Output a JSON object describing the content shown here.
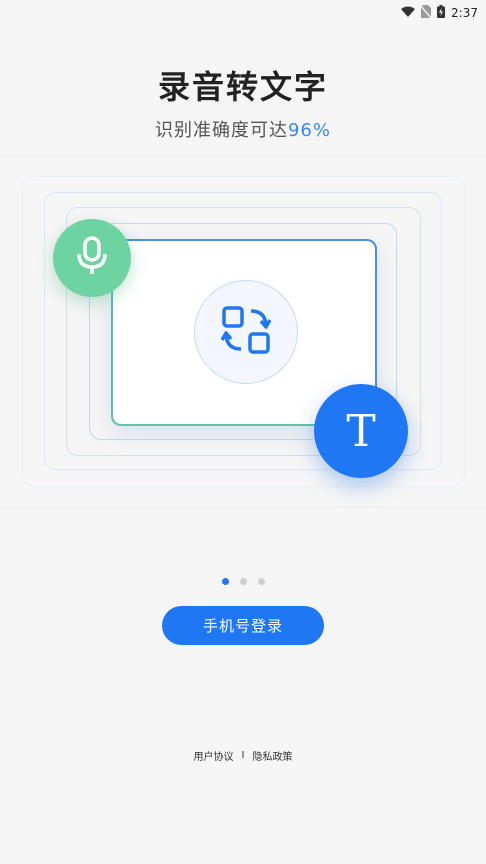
{
  "status_bar": {
    "time": "2:37",
    "icons": [
      "wifi-icon",
      "no-sim-icon",
      "battery-charging-icon"
    ]
  },
  "onboarding": {
    "title": "录音转文字",
    "subtitle_prefix": "识别准确度可达",
    "subtitle_accent": "96%",
    "text_symbol": "T",
    "page_count": 3,
    "active_page": 1
  },
  "actions": {
    "login_label": "手机号登录"
  },
  "footer": {
    "user_agreement": "用户协议",
    "separator": "I",
    "privacy_policy": "隐私政策"
  },
  "colors": {
    "accent": "#1f77f3",
    "mic_green": "#6ed3a2",
    "percent_blue": "#3a86f7"
  }
}
